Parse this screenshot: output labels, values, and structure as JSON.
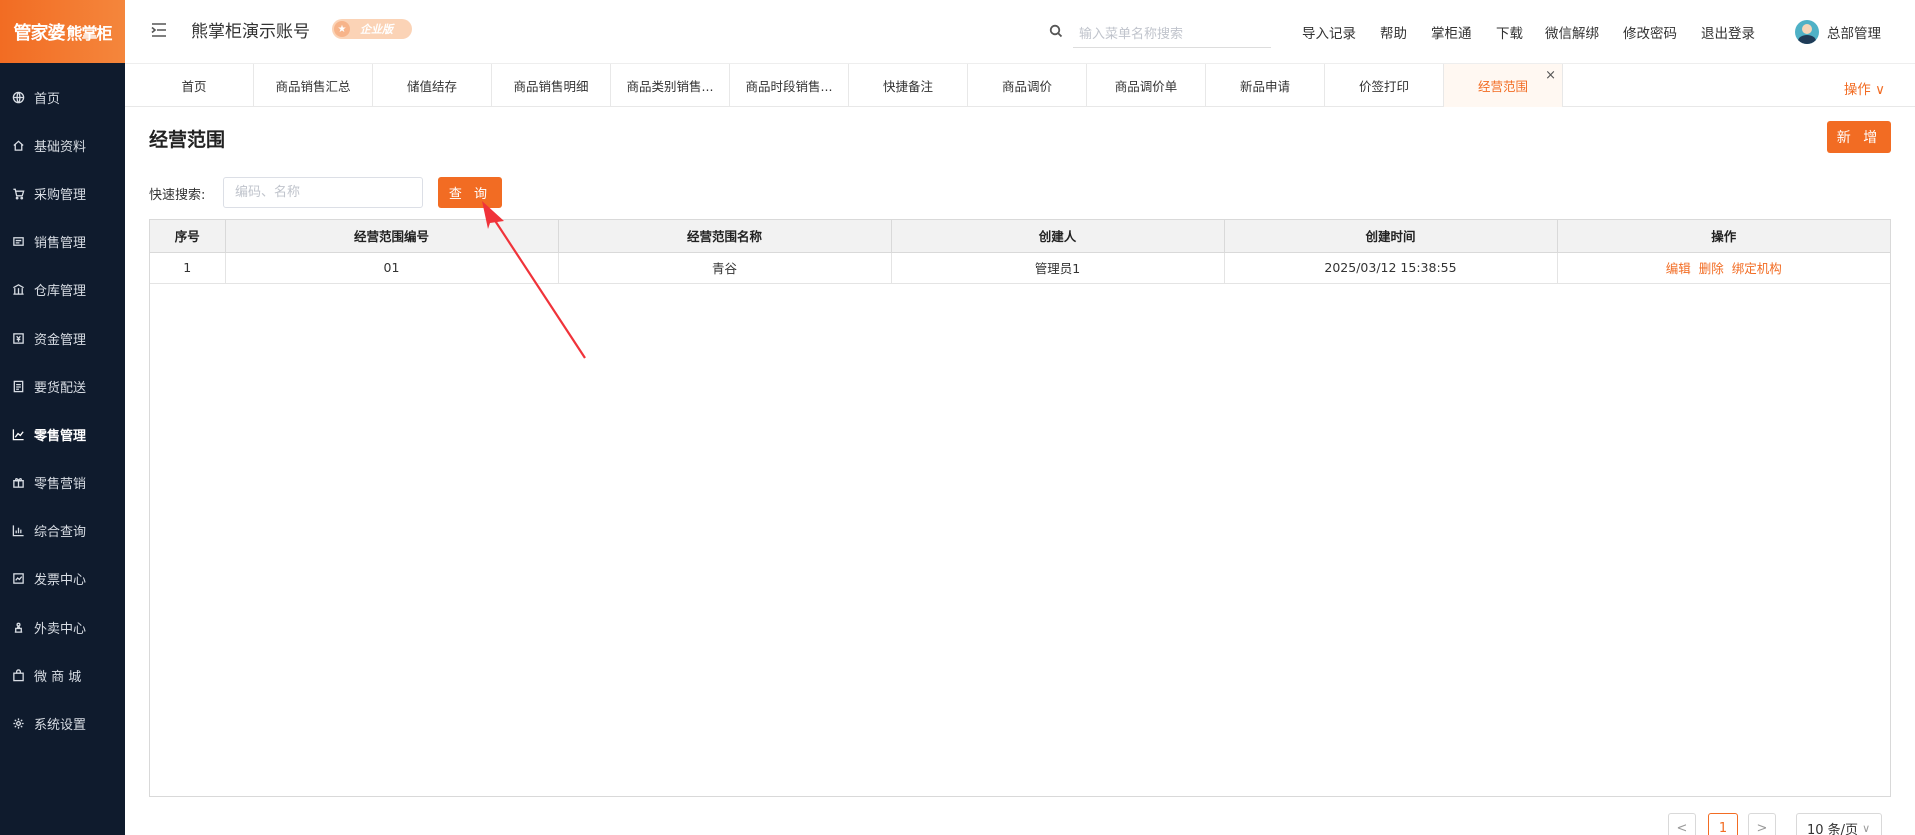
{
  "brand": {
    "logo_a": "管家婆",
    "logo_b": "熊掌柜"
  },
  "sidebar": {
    "items": [
      {
        "label": "首页",
        "icon": "globe-icon"
      },
      {
        "label": "基础资料",
        "icon": "home-icon"
      },
      {
        "label": "采购管理",
        "icon": "cart-icon"
      },
      {
        "label": "销售管理",
        "icon": "sales-icon"
      },
      {
        "label": "仓库管理",
        "icon": "warehouse-icon"
      },
      {
        "label": "资金管理",
        "icon": "money-icon"
      },
      {
        "label": "要货配送",
        "icon": "list-icon"
      },
      {
        "label": "零售管理",
        "icon": "chart-icon",
        "active": true
      },
      {
        "label": "零售营销",
        "icon": "gift-icon"
      },
      {
        "label": "综合查询",
        "icon": "bar-chart-icon"
      },
      {
        "label": "发票中心",
        "icon": "invoice-icon"
      },
      {
        "label": "外卖中心",
        "icon": "delivery-icon"
      },
      {
        "label": "微 商 城",
        "icon": "bag-icon"
      },
      {
        "label": "系统设置",
        "icon": "gear-icon"
      }
    ]
  },
  "header": {
    "account": "熊掌柜演示账号",
    "edition_badge": "企业版",
    "search_placeholder": "输入菜单名称搜索",
    "links": [
      "导入记录",
      "帮助",
      "掌柜通",
      "下载",
      "微信解绑",
      "修改密码",
      "退出登录"
    ],
    "user": "总部管理"
  },
  "tabs": {
    "items": [
      "首页",
      "商品销售汇总",
      "储值结存",
      "商品销售明细",
      "商品类别销售...",
      "商品时段销售...",
      "快捷备注",
      "商品调价",
      "商品调价单",
      "新品申请",
      "价签打印",
      "经营范围"
    ],
    "active_index": 11,
    "close": "×",
    "operations": "操作 ∨"
  },
  "page": {
    "title": "经营范围",
    "add_button": "新 增",
    "quick_search_label": "快速搜索:",
    "quick_search_placeholder": "编码、名称",
    "query_button": "查 询"
  },
  "table": {
    "columns": [
      "序号",
      "经营范围编号",
      "经营范围名称",
      "创建人",
      "创建时间",
      "操作"
    ],
    "rows": [
      {
        "index": "1",
        "code": "01",
        "name": "青谷",
        "creator": "管理员1",
        "created_at": "2025/03/12 15:38:55",
        "actions": [
          "编辑",
          "删除",
          "绑定机构"
        ]
      }
    ]
  },
  "pagination": {
    "prev": "<",
    "current": "1",
    "next": ">",
    "page_size": "10 条/页"
  },
  "colors": {
    "accent": "#f26c23",
    "sidebar": "#0f1b2d"
  }
}
